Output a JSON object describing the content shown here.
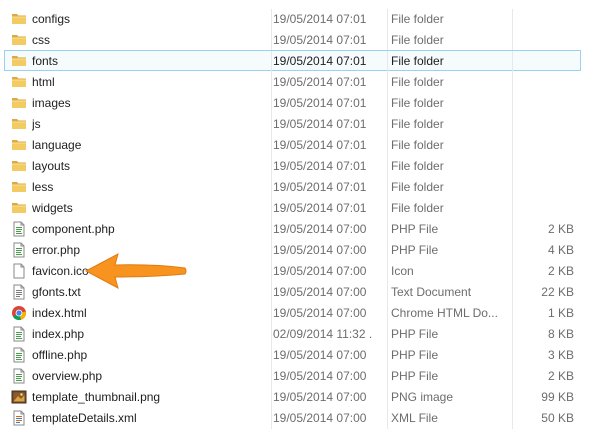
{
  "files": [
    {
      "name": "configs",
      "date": "19/05/2014 07:01",
      "type": "File folder",
      "size": "",
      "icon": "folder-icon"
    },
    {
      "name": "css",
      "date": "19/05/2014 07:01",
      "type": "File folder",
      "size": "",
      "icon": "folder-icon"
    },
    {
      "name": "fonts",
      "date": "19/05/2014 07:01",
      "type": "File folder",
      "size": "",
      "icon": "folder-icon",
      "selected": true
    },
    {
      "name": "html",
      "date": "19/05/2014 07:01",
      "type": "File folder",
      "size": "",
      "icon": "folder-icon"
    },
    {
      "name": "images",
      "date": "19/05/2014 07:01",
      "type": "File folder",
      "size": "",
      "icon": "folder-icon"
    },
    {
      "name": "js",
      "date": "19/05/2014 07:01",
      "type": "File folder",
      "size": "",
      "icon": "folder-icon"
    },
    {
      "name": "language",
      "date": "19/05/2014 07:01",
      "type": "File folder",
      "size": "",
      "icon": "folder-icon"
    },
    {
      "name": "layouts",
      "date": "19/05/2014 07:01",
      "type": "File folder",
      "size": "",
      "icon": "folder-icon"
    },
    {
      "name": "less",
      "date": "19/05/2014 07:01",
      "type": "File folder",
      "size": "",
      "icon": "folder-icon"
    },
    {
      "name": "widgets",
      "date": "19/05/2014 07:01",
      "type": "File folder",
      "size": "",
      "icon": "folder-icon"
    },
    {
      "name": "component.php",
      "date": "19/05/2014 07:00",
      "type": "PHP File",
      "size": "2 KB",
      "icon": "php-file-icon"
    },
    {
      "name": "error.php",
      "date": "19/05/2014 07:00",
      "type": "PHP File",
      "size": "4 KB",
      "icon": "php-file-icon"
    },
    {
      "name": "favicon.ico",
      "date": "19/05/2014 07:00",
      "type": "Icon",
      "size": "2 KB",
      "icon": "blank-file-icon"
    },
    {
      "name": "gfonts.txt",
      "date": "19/05/2014 07:00",
      "type": "Text Document",
      "size": "22 KB",
      "icon": "text-file-icon"
    },
    {
      "name": "index.html",
      "date": "19/05/2014 07:00",
      "type": "Chrome HTML Do...",
      "size": "1 KB",
      "icon": "chrome-icon"
    },
    {
      "name": "index.php",
      "date": "02/09/2014 11:32 ...",
      "type": "PHP File",
      "size": "8 KB",
      "icon": "php-file-icon"
    },
    {
      "name": "offline.php",
      "date": "19/05/2014 07:00",
      "type": "PHP File",
      "size": "3 KB",
      "icon": "php-file-icon"
    },
    {
      "name": "overview.php",
      "date": "19/05/2014 07:00",
      "type": "PHP File",
      "size": "2 KB",
      "icon": "php-file-icon"
    },
    {
      "name": "template_thumbnail.png",
      "date": "19/05/2014 07:00",
      "type": "PNG image",
      "size": "99 KB",
      "icon": "image-file-icon"
    },
    {
      "name": "templateDetails.xml",
      "date": "19/05/2014 07:00",
      "type": "XML File",
      "size": "50 KB",
      "icon": "xml-file-icon"
    }
  ],
  "colors": {
    "selection_bg": "#f6fbfe",
    "selection_border": "#99d1ef",
    "folder": "#e8b94a",
    "arrow": "#f7931e"
  },
  "annotation": {
    "icon": "arrow-left-icon",
    "points_to": "favicon.ico"
  }
}
